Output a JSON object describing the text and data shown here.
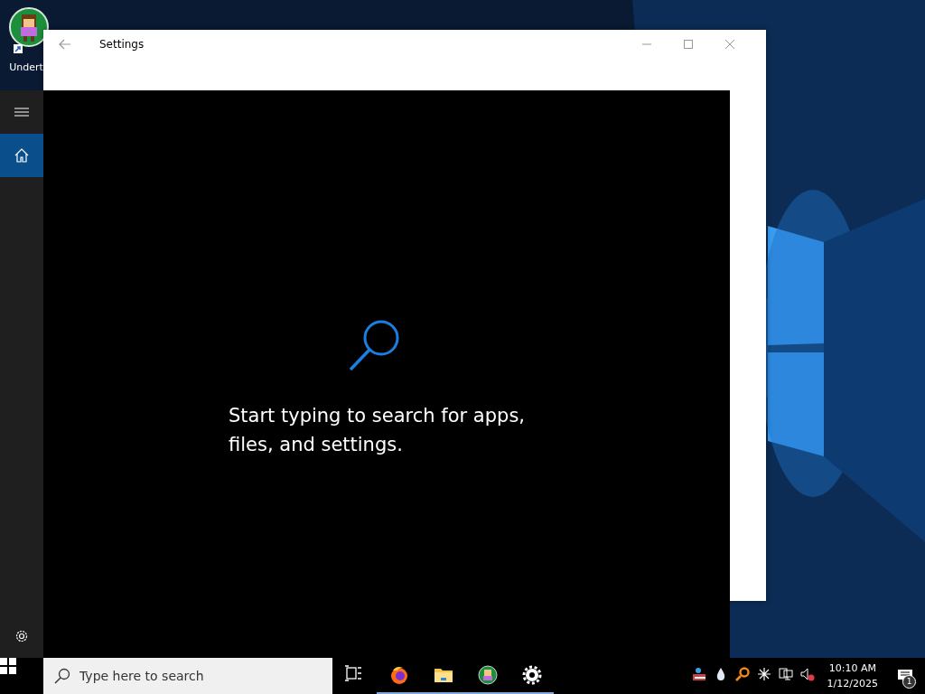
{
  "desktop": {
    "icons": [
      {
        "label": "Undert"
      }
    ]
  },
  "settings_window": {
    "title": "Settings"
  },
  "start_panel": {
    "rail": [
      {
        "kind": "menu",
        "selected": false
      },
      {
        "kind": "home",
        "selected": true
      },
      {
        "kind": "settings",
        "selected": false
      }
    ],
    "message": "Start typing to search for apps, files, and settings."
  },
  "taskbar": {
    "search": {
      "placeholder": "Type here to search"
    },
    "apps": [
      {
        "kind": "taskview",
        "running": false
      },
      {
        "kind": "firefox",
        "running": true
      },
      {
        "kind": "explorer",
        "running": true
      },
      {
        "kind": "game",
        "running": true
      },
      {
        "kind": "settings",
        "running": true
      }
    ],
    "tray": [
      {
        "kind": "people"
      },
      {
        "kind": "drop"
      },
      {
        "kind": "magnifier"
      },
      {
        "kind": "star"
      },
      {
        "kind": "network"
      },
      {
        "kind": "mute"
      }
    ],
    "time": "10:10 AM",
    "date": "1/12/2025",
    "notifications": "1"
  }
}
